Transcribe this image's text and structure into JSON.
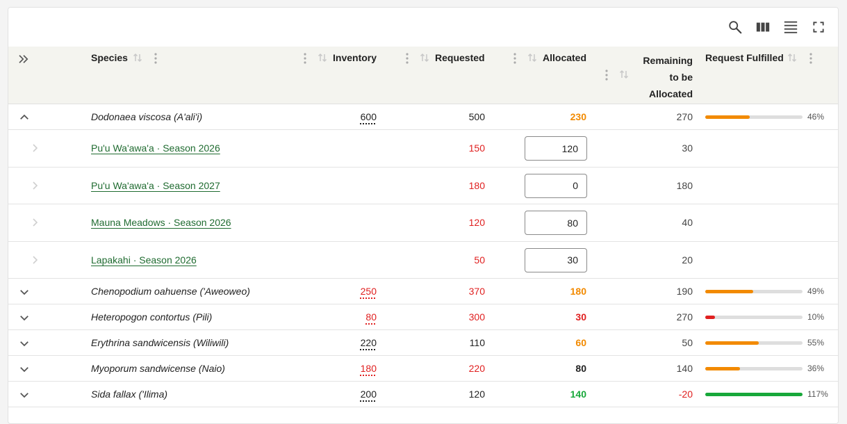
{
  "toolbar": {
    "icons": [
      "search-icon",
      "view-columns-icon",
      "density-icon",
      "fullscreen-icon"
    ]
  },
  "headers": {
    "species": "Species",
    "inventory": "Inventory",
    "requested": "Requested",
    "allocated": "Allocated",
    "remaining_l1": "Remaining",
    "remaining_l2": "to be",
    "remaining_l3": "Allocated",
    "fulfilled": "Request Fulfilled"
  },
  "colors": {
    "red": "#e02020",
    "orange": "#f28a00",
    "green": "#18a83a",
    "link": "#1f6b30",
    "header_bg": "#f4f4ef"
  },
  "expanded_species": {
    "name": "Dodonaea viscosa (A'ali'i)",
    "inventory": "600",
    "requested": "500",
    "allocated": "230",
    "remaining": "270",
    "fulfilled_pct": "46%",
    "fulfilled": 0.46
  },
  "requests": [
    {
      "label": "Pu'u Wa'awa'a · Season 2026",
      "requested": "150",
      "allocated": "120",
      "remaining": "30"
    },
    {
      "label": "Pu'u Wa'awa'a · Season 2027",
      "requested": "180",
      "allocated": "0",
      "remaining": "180"
    },
    {
      "label": "Mauna Meadows · Season 2026",
      "requested": "120",
      "allocated": "80",
      "remaining": "40"
    },
    {
      "label": "Lapakahi · Season 2026",
      "requested": "50",
      "allocated": "30",
      "remaining": "20"
    }
  ],
  "species": [
    {
      "name": "Chenopodium oahuense ('Aweoweo)",
      "inventory": "250",
      "requested": "370",
      "allocated": "180",
      "remaining": "190",
      "fulfilled_pct": "49%",
      "fulfilled": 0.49
    },
    {
      "name": "Heteropogon contortus (Pili)",
      "inventory": "80",
      "requested": "300",
      "allocated": "30",
      "remaining": "270",
      "fulfilled_pct": "10%",
      "fulfilled": 0.1
    },
    {
      "name": "Erythrina sandwicensis (Wiliwili)",
      "inventory": "220",
      "requested": "110",
      "allocated": "60",
      "remaining": "50",
      "fulfilled_pct": "55%",
      "fulfilled": 0.55
    },
    {
      "name": "Myoporum sandwicense (Naio)",
      "inventory": "180",
      "requested": "220",
      "allocated": "80",
      "remaining": "140",
      "fulfilled_pct": "36%",
      "fulfilled": 0.36
    },
    {
      "name": "Sida fallax ('Ilima)",
      "inventory": "200",
      "requested": "120",
      "allocated": "140",
      "remaining": "-20",
      "fulfilled_pct": "117%",
      "fulfilled": 1.17
    }
  ]
}
